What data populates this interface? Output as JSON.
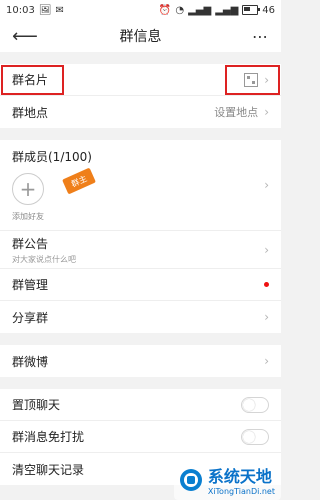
{
  "status_bar": {
    "time": "10:03",
    "battery": "46",
    "battery_level": 0.46,
    "left_icons": [
      "image-icon",
      "mail-icon"
    ],
    "right_icons": [
      "alarm-icon",
      "wifi-icon",
      "signal-icon",
      "signal-icon",
      "battery-icon"
    ]
  },
  "navbar": {
    "title": "群信息",
    "back_icon": "arrow-left-icon",
    "more_icon": "more-icon",
    "more_label": "⋯"
  },
  "section1": {
    "card": {
      "label": "群名片"
    },
    "location": {
      "label": "群地点",
      "value": "设置地点"
    }
  },
  "members": {
    "title": "群成员(1/100)",
    "add_label": "添加好友",
    "owner_tag": "群主"
  },
  "section3": {
    "announcement": {
      "label": "群公告",
      "sub": "对大家说点什么吧"
    },
    "manage": {
      "label": "群管理"
    },
    "share": {
      "label": "分享群"
    }
  },
  "section4": {
    "weibo": {
      "label": "群微博"
    }
  },
  "section5": {
    "pin": {
      "label": "置顶聊天"
    },
    "mute": {
      "label": "群消息免打扰"
    },
    "clear": {
      "label": "清空聊天记录"
    }
  },
  "watermark": {
    "title": "系统天地",
    "url": "XiTongTianDi.net"
  },
  "colors": {
    "highlight": "#dd2222",
    "tag": "#ef7f1a",
    "dot": "#ee1111",
    "watermark": "#0a72c9"
  }
}
